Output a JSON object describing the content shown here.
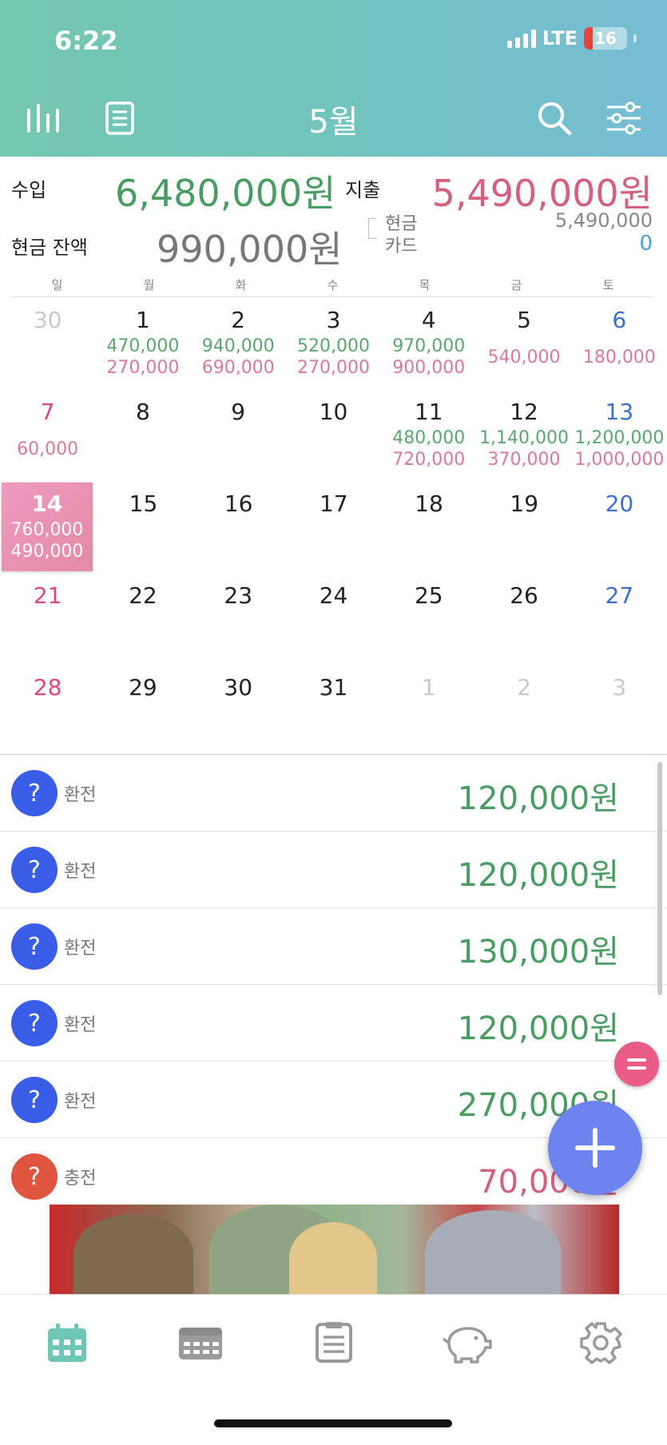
{
  "status": {
    "time": "6:22",
    "network": "LTE",
    "battery": "16"
  },
  "header": {
    "title": "5월"
  },
  "summary": {
    "income_label": "수입",
    "income_value": "6,480,000원",
    "expense_label": "지출",
    "expense_value": "5,490,000원",
    "cash_balance_label": "현금 잔액",
    "cash_balance_value": "990,000원",
    "cash_label": "현금",
    "cash_value": "5,490,000",
    "card_label": "카드",
    "card_value": "0"
  },
  "weekdays": [
    "일",
    "월",
    "화",
    "수",
    "목",
    "금",
    "토"
  ],
  "calendar": {
    "weeks": [
      [
        {
          "d": "30",
          "inc": "",
          "exp": "",
          "other": true
        },
        {
          "d": "1",
          "inc": "470,000",
          "exp": "270,000"
        },
        {
          "d": "2",
          "inc": "940,000",
          "exp": "690,000"
        },
        {
          "d": "3",
          "inc": "520,000",
          "exp": "270,000"
        },
        {
          "d": "4",
          "inc": "970,000",
          "exp": "900,000"
        },
        {
          "d": "5",
          "inc": "",
          "exp": "540,000"
        },
        {
          "d": "6",
          "inc": "",
          "exp": "180,000"
        }
      ],
      [
        {
          "d": "7",
          "inc": "",
          "exp": "60,000"
        },
        {
          "d": "8",
          "inc": "",
          "exp": ""
        },
        {
          "d": "9",
          "inc": "",
          "exp": ""
        },
        {
          "d": "10",
          "inc": "",
          "exp": ""
        },
        {
          "d": "11",
          "inc": "480,000",
          "exp": "720,000"
        },
        {
          "d": "12",
          "inc": "1,140,000",
          "exp": "370,000"
        },
        {
          "d": "13",
          "inc": "1,200,000",
          "exp": "1,000,000"
        }
      ],
      [
        {
          "d": "14",
          "inc": "760,000",
          "exp": "490,000",
          "selected": true
        },
        {
          "d": "15",
          "inc": "",
          "exp": ""
        },
        {
          "d": "16",
          "inc": "",
          "exp": ""
        },
        {
          "d": "17",
          "inc": "",
          "exp": ""
        },
        {
          "d": "18",
          "inc": "",
          "exp": ""
        },
        {
          "d": "19",
          "inc": "",
          "exp": ""
        },
        {
          "d": "20",
          "inc": "",
          "exp": ""
        }
      ],
      [
        {
          "d": "21",
          "inc": "",
          "exp": ""
        },
        {
          "d": "22",
          "inc": "",
          "exp": ""
        },
        {
          "d": "23",
          "inc": "",
          "exp": ""
        },
        {
          "d": "24",
          "inc": "",
          "exp": ""
        },
        {
          "d": "25",
          "inc": "",
          "exp": ""
        },
        {
          "d": "26",
          "inc": "",
          "exp": ""
        },
        {
          "d": "27",
          "inc": "",
          "exp": ""
        }
      ],
      [
        {
          "d": "28",
          "inc": "",
          "exp": ""
        },
        {
          "d": "29",
          "inc": "",
          "exp": ""
        },
        {
          "d": "30",
          "inc": "",
          "exp": ""
        },
        {
          "d": "31",
          "inc": "",
          "exp": ""
        },
        {
          "d": "1",
          "inc": "",
          "exp": "",
          "other": true
        },
        {
          "d": "2",
          "inc": "",
          "exp": "",
          "other": true
        },
        {
          "d": "3",
          "inc": "",
          "exp": "",
          "other": true
        }
      ]
    ]
  },
  "transactions": [
    {
      "icon": "?",
      "category": "환전",
      "amount": "120,000원",
      "type": "income"
    },
    {
      "icon": "?",
      "category": "환전",
      "amount": "120,000원",
      "type": "income"
    },
    {
      "icon": "?",
      "category": "환전",
      "amount": "130,000원",
      "type": "income"
    },
    {
      "icon": "?",
      "category": "환전",
      "amount": "120,000원",
      "type": "income"
    },
    {
      "icon": "?",
      "category": "환전",
      "amount": "270,000원",
      "type": "income"
    },
    {
      "icon": "?",
      "category": "충전",
      "amount": "70,000원",
      "type": "expense"
    }
  ],
  "colors": {
    "income": "#4a9d62",
    "expense": "#d45f7e",
    "income_avatar": "#3a5de8",
    "expense_avatar": "#e0553f",
    "tab_active": "#6ec6b4",
    "tab_inactive": "#9a9a9a"
  },
  "tabs": [
    "calendar-icon",
    "weekly-icon",
    "list-icon",
    "piggy-bank-icon",
    "gear-icon"
  ]
}
